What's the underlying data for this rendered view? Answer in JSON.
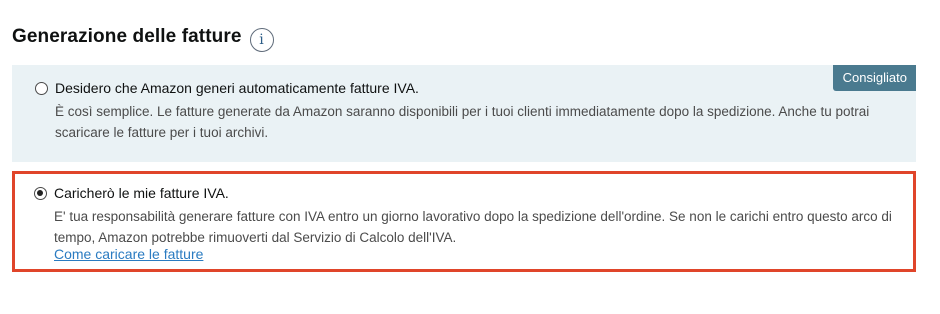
{
  "section": {
    "title": "Generazione delle fatture",
    "info_icon_glyph": "i"
  },
  "options": {
    "auto": {
      "label": "Desidero che Amazon generi automaticamente fatture IVA.",
      "description": "È così semplice. Le fatture generate da Amazon saranno disponibili per i tuoi clienti immediatamente dopo la spedizione. Anche tu potrai scaricare le fatture per i tuoi archivi.",
      "badge": "Consigliato",
      "selected": false
    },
    "upload": {
      "label": "Caricherò le mie fatture IVA.",
      "description": "E' tua responsabilità generare fatture con IVA entro un giorno lavorativo dopo la spedizione dell'ordine. Se non le carichi entro questo arco di tempo, Amazon potrebbe rimuoverti dal Servizio di Calcolo dell'IVA.",
      "link": "Come caricare le fatture",
      "selected": true
    }
  },
  "colors": {
    "highlight_border": "#e0452a",
    "recommended_bg": "#eaf2f5",
    "badge_bg": "#4a7a8f",
    "link": "#2a7bc1"
  }
}
